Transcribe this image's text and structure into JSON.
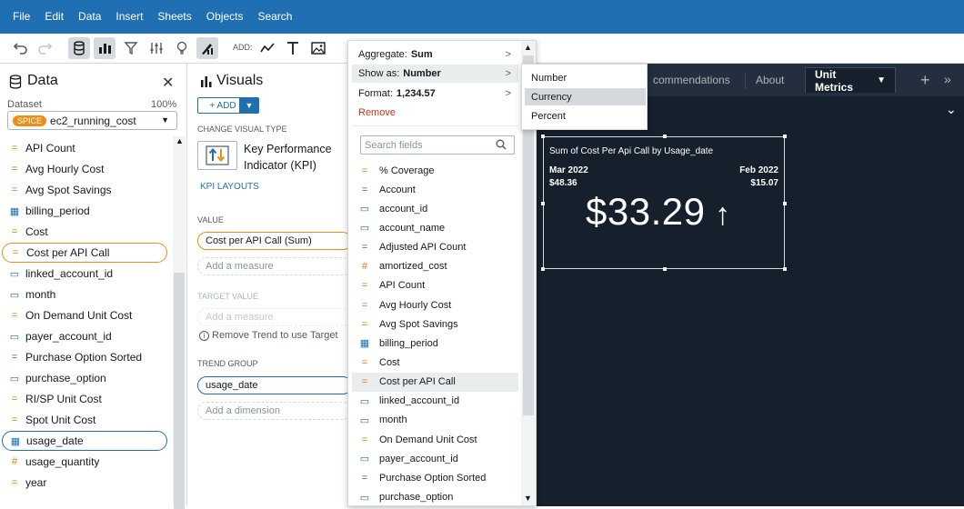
{
  "menubar": [
    "File",
    "Edit",
    "Data",
    "Insert",
    "Sheets",
    "Objects",
    "Search"
  ],
  "toolbar": {
    "add_label": "ADD:"
  },
  "data_panel": {
    "title": "Data",
    "dataset_label": "Dataset",
    "dataset_pct": "100%",
    "spice_badge": "SPICE",
    "dataset_name": "ec2_running_cost",
    "fields": [
      {
        "label": "API Count",
        "type": "measure"
      },
      {
        "label": "Avg Hourly Cost",
        "type": "measure"
      },
      {
        "label": "Avg Spot Savings",
        "type": "measure"
      },
      {
        "label": "billing_period",
        "type": "date"
      },
      {
        "label": "Cost",
        "type": "measure"
      },
      {
        "label": "Cost per API Call",
        "type": "measure",
        "selected": true
      },
      {
        "label": "linked_account_id",
        "type": "dimension"
      },
      {
        "label": "month",
        "type": "dimension"
      },
      {
        "label": "On Demand Unit Cost",
        "type": "measure"
      },
      {
        "label": "payer_account_id",
        "type": "dimension"
      },
      {
        "label": "Purchase Option Sorted",
        "type": "calc"
      },
      {
        "label": "purchase_option",
        "type": "dimension"
      },
      {
        "label": "RI/SP Unit Cost",
        "type": "measure"
      },
      {
        "label": "Spot Unit Cost",
        "type": "measure"
      },
      {
        "label": "usage_date",
        "type": "date",
        "selected": true
      },
      {
        "label": "usage_quantity",
        "type": "number"
      },
      {
        "label": "year",
        "type": "measure"
      }
    ]
  },
  "visuals_panel": {
    "title": "Visuals",
    "add_button": "+ ADD",
    "change_visual_type": "CHANGE VISUAL TYPE",
    "visual_type_name": "Key Performance Indicator (KPI)",
    "kpi_layouts": "KPI LAYOUTS",
    "value_label": "VALUE",
    "value_field": "Cost per API Call (Sum)",
    "add_measure": "Add a measure",
    "target_label": "TARGET VALUE",
    "target_placeholder": "Add a measure",
    "trend_note": "Remove Trend to use Target",
    "trend_label": "TREND GROUP",
    "trend_field": "usage_date",
    "add_dimension": "Add a dimension"
  },
  "field_menu": {
    "aggregate_label": "Aggregate:",
    "aggregate_value": "Sum",
    "show_as_label": "Show as:",
    "show_as_value": "Number",
    "format_label": "Format:",
    "format_value": "1,234.57",
    "remove": "Remove",
    "search_placeholder": "Search fields",
    "fields": [
      {
        "label": "% Coverage",
        "type": "measure"
      },
      {
        "label": "Account",
        "type": "calc"
      },
      {
        "label": "account_id",
        "type": "dimension"
      },
      {
        "label": "account_name",
        "type": "dimension"
      },
      {
        "label": "Adjusted API Count",
        "type": "calc"
      },
      {
        "label": "amortized_cost",
        "type": "number"
      },
      {
        "label": "API Count",
        "type": "measure"
      },
      {
        "label": "Avg Hourly Cost",
        "type": "measure"
      },
      {
        "label": "Avg Spot Savings",
        "type": "measure"
      },
      {
        "label": "billing_period",
        "type": "date"
      },
      {
        "label": "Cost",
        "type": "measure"
      },
      {
        "label": "Cost per API Call",
        "type": "measure",
        "highlighted": true
      },
      {
        "label": "linked_account_id",
        "type": "dimension"
      },
      {
        "label": "month",
        "type": "dimension"
      },
      {
        "label": "On Demand Unit Cost",
        "type": "measure"
      },
      {
        "label": "payer_account_id",
        "type": "dimension"
      },
      {
        "label": "Purchase Option Sorted",
        "type": "calc"
      },
      {
        "label": "purchase_option",
        "type": "dimension"
      }
    ]
  },
  "show_as_submenu": {
    "options": [
      "Number",
      "Currency",
      "Percent"
    ],
    "highlighted": "Currency"
  },
  "canvas": {
    "tabs": [
      "commendations",
      "About",
      "Unit Metrics"
    ],
    "active_tab": "Unit Metrics",
    "kpi": {
      "title": "Sum of Cost Per Api Call by Usage_date",
      "left_date": "Mar 2022",
      "left_value": "$48.36",
      "right_date": "Feb 2022",
      "right_value": "$15.07",
      "value": "$33.29",
      "arrow": "↑"
    }
  },
  "colors": {
    "menubar": "#1f6fb2",
    "accent_orange": "#ec8f16",
    "canvas_bg": "#16202c",
    "remove": "#d13212"
  }
}
